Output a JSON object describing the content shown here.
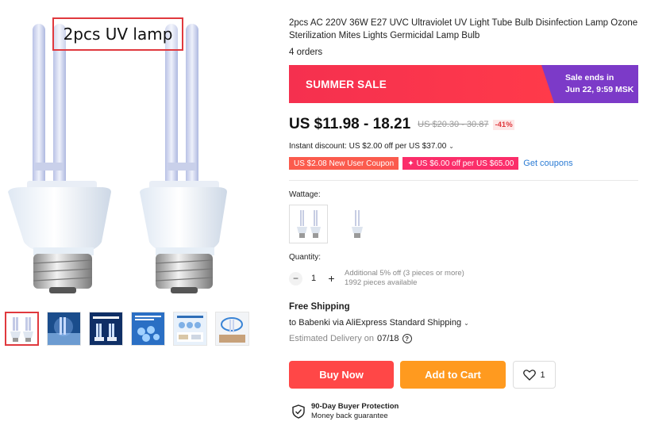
{
  "gallery": {
    "caption": "2pcs UV lamp",
    "thumbnails": [
      {
        "icon": "uv-lamp-pair-thumb"
      },
      {
        "icon": "uv-room-thumb"
      },
      {
        "icon": "uv-germicidal-lamp-thumb"
      },
      {
        "icon": "uv-sterilize-thumb"
      },
      {
        "icon": "uv-bedding-thumb"
      },
      {
        "icon": "uv-360-thumb"
      }
    ]
  },
  "product": {
    "title": "2pcs AC 220V 36W E27 UVC Ultraviolet UV Light Tube Bulb Disinfection Lamp Ozone Sterilization Mites Lights Germicidal Lamp Bulb",
    "orders": "4 orders"
  },
  "banner": {
    "sale_label": "SUMMER SALE",
    "ends_line1": "Sale ends in",
    "ends_line2": "Jun 22, 9:59 MSK",
    "color_left": "#f5304f",
    "color_right": "#7c3ac8"
  },
  "price": {
    "current": "US $11.98 - 18.21",
    "original": "US $20.30 - 30.87",
    "discount": "-41%"
  },
  "instant_discount": "Instant discount: US $2.00 off per US $37.00",
  "coupons": {
    "new_user": "US $2.08 New User Coupon",
    "store": "US $6.00 off per US $65.00",
    "get_link": "Get coupons"
  },
  "wattage": {
    "label": "Wattage:",
    "options": [
      {
        "icon": "double-bulb-option",
        "selected": true
      },
      {
        "icon": "single-bulb-option",
        "selected": false
      }
    ]
  },
  "quantity": {
    "label": "Quantity:",
    "value": "1",
    "note_line1": "Additional 5% off (3 pieces or more)",
    "note_line2": "1992 pieces available"
  },
  "shipping": {
    "title": "Free Shipping",
    "to": "to Babenki via AliExpress Standard Shipping",
    "estimated_label": "Estimated Delivery on",
    "estimated_date": "07/18"
  },
  "actions": {
    "buy": "Buy Now",
    "cart": "Add to Cart",
    "wish_count": "1",
    "buy_color": "#ff4747",
    "cart_color": "#ff9a1f"
  },
  "protection": {
    "title": "90-Day Buyer Protection",
    "subtitle": "Money back guarantee"
  }
}
